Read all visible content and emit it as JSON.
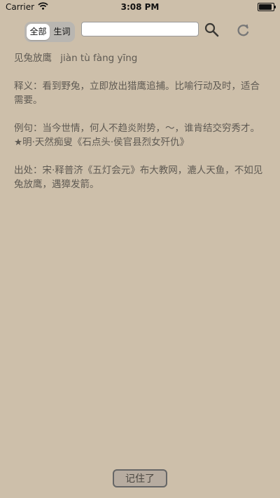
{
  "status_bar": {
    "carrier": "Carrier",
    "time": "3:08 PM",
    "battery_level": 0.9
  },
  "toolbar": {
    "segments": [
      "全部",
      "生词"
    ],
    "selected_segment": "全部",
    "search_placeholder": "",
    "search_value": "",
    "search_icon": "search-icon",
    "refresh_icon": "refresh-icon"
  },
  "entry": {
    "headword": "见兔放鹰",
    "pinyin": "jiàn tù fàng yīng",
    "meaning": "释义：看到野兔，立即放出猎鹰追捕。比喻行动及时，适合需要。",
    "example": "例句：当今世情，何人不趋炎附势，～，谁肯结交穷秀才。★明·天然痴叟《石点头·侯官县烈女歼仇》",
    "source": "出处：宋·释普济《五灯会元》布大教网，漉人天鱼，不如见兔放鹰，遇獐发箭。"
  },
  "footer": {
    "remember_label": "记住了"
  }
}
